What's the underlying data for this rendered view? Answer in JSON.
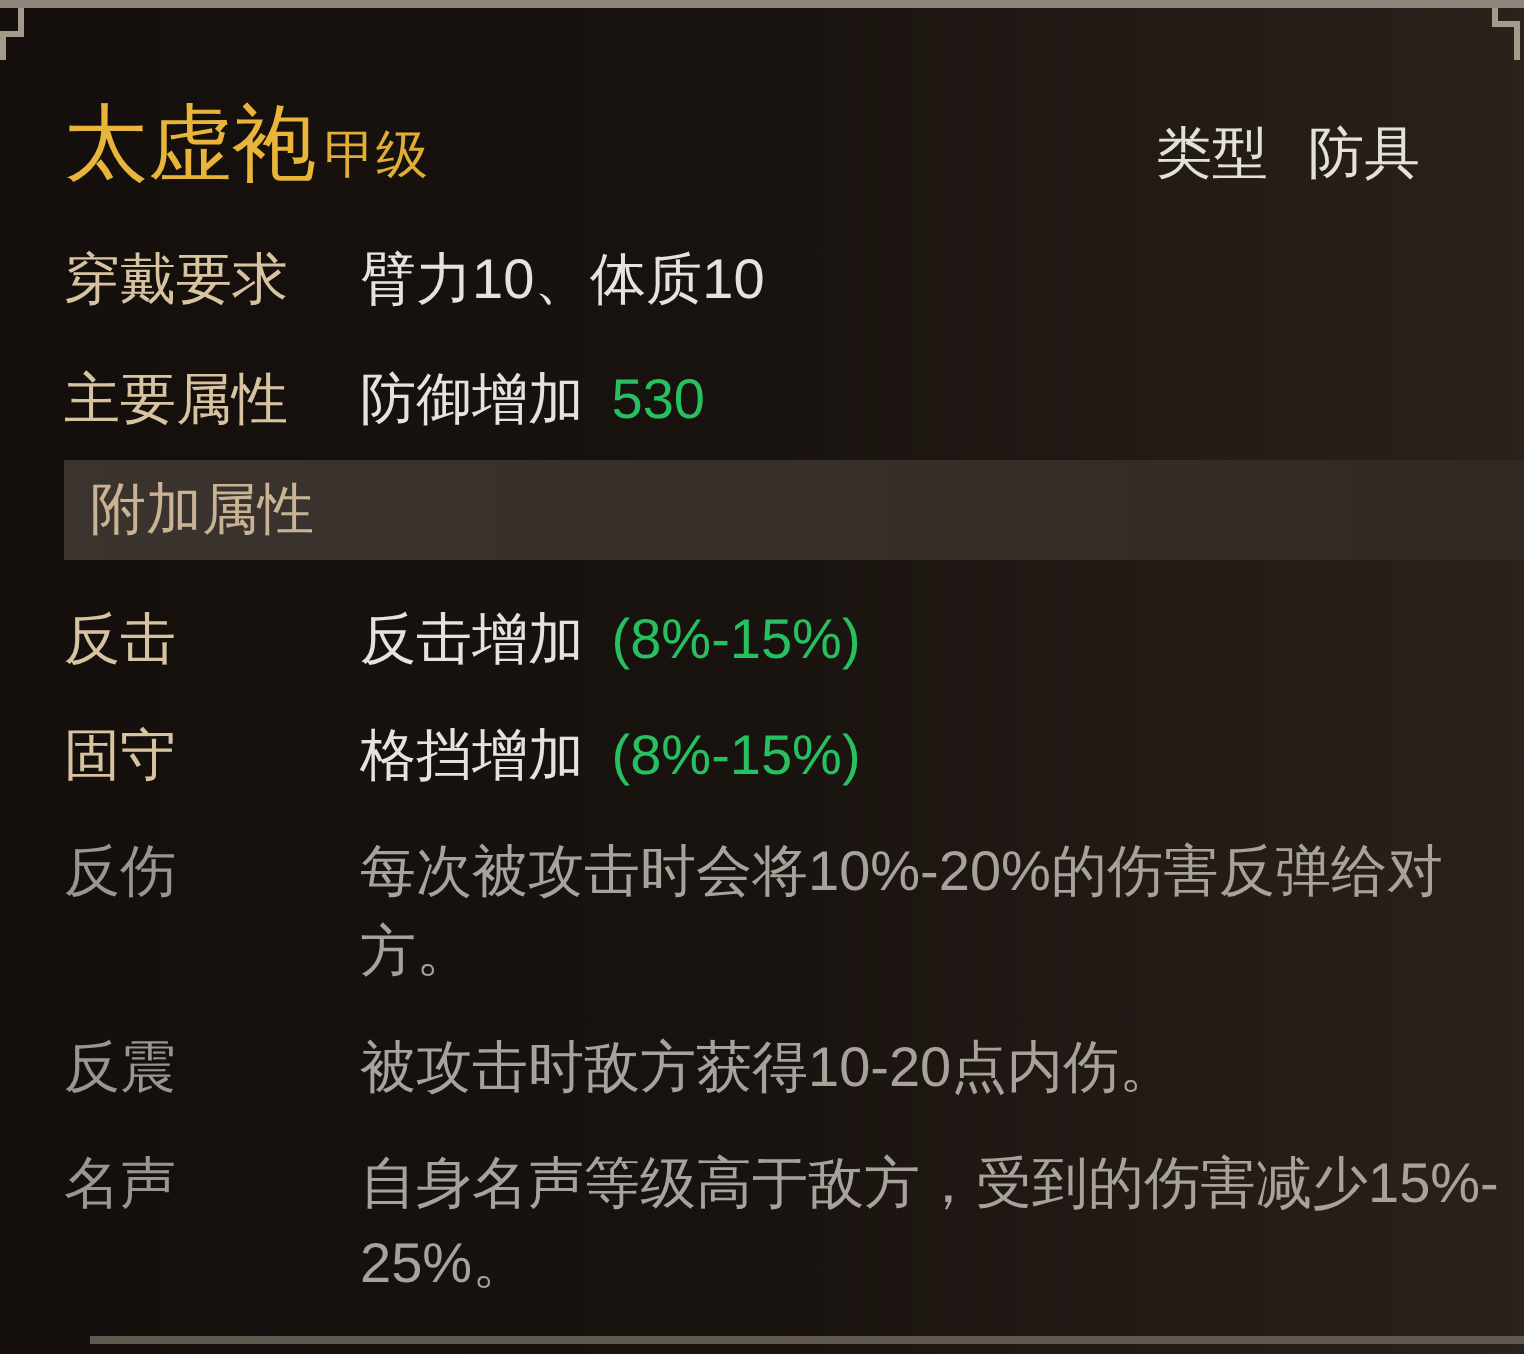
{
  "item": {
    "name": "太虚袍",
    "grade": "甲级",
    "type_label": "类型",
    "type_value": "防具"
  },
  "requirements": {
    "label": "穿戴要求",
    "value": "臂力10、体质10"
  },
  "main_attribute": {
    "label": "主要属性",
    "effect": "防御增加",
    "amount": "530"
  },
  "extra_attributes": {
    "heading": "附加属性",
    "items": [
      {
        "name": "反击",
        "effect": "反击增加",
        "range": "(8%-15%)",
        "active": true
      },
      {
        "name": "固守",
        "effect": "格挡增加",
        "range": "(8%-15%)",
        "active": true
      },
      {
        "name": "反伤",
        "effect": "每次被攻击时会将10%-20%的伤害反弹给对方。",
        "active": false
      },
      {
        "name": "反震",
        "effect": "被攻击时敌方获得10-20点内伤。",
        "active": false
      },
      {
        "name": "名声",
        "effect": "自身名声等级高于敌方，受到的伤害减少15%-25%。",
        "active": false
      }
    ]
  }
}
